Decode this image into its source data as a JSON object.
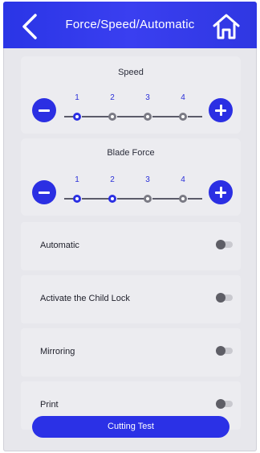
{
  "header": {
    "title": "Force/Speed/Automatic",
    "back_icon": "chevron-left-icon",
    "home_icon": "home-icon"
  },
  "speed": {
    "title": "Speed",
    "steps": [
      "1",
      "2",
      "3",
      "4"
    ],
    "selected": 1
  },
  "blade_force": {
    "title": "Blade Force",
    "steps": [
      "1",
      "2",
      "3",
      "4"
    ],
    "selected": 2
  },
  "settings": [
    {
      "label": "Automatic",
      "on": false
    },
    {
      "label": "Activate the Child Lock",
      "on": false
    },
    {
      "label": "Mirroring",
      "on": false
    },
    {
      "label": "Print",
      "on": false
    }
  ],
  "cutting_test": {
    "label": "Cutting Test"
  },
  "colors": {
    "accent": "#2b2fe3",
    "background": "#e7e7ec",
    "inactive_dot": "#7a7a84"
  }
}
